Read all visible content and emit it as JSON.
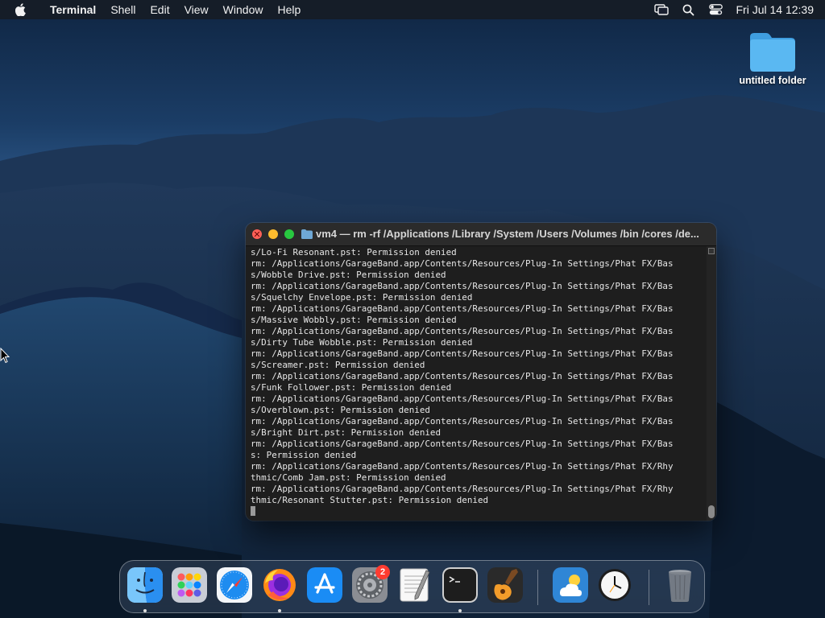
{
  "menubar": {
    "app_name": "Terminal",
    "menus": [
      "Shell",
      "Edit",
      "View",
      "Window",
      "Help"
    ],
    "clock": "Fri Jul 14  12:39"
  },
  "desktop": {
    "folder_label": "untitled folder"
  },
  "terminal": {
    "title": "vm4 — rm -rf /Applications /Library /System /Users /Volumes /bin /cores /de...",
    "lines": [
      "s/Lo-Fi Resonant.pst: Permission denied",
      "rm: /Applications/GarageBand.app/Contents/Resources/Plug-In Settings/Phat FX/Bas",
      "s/Wobble Drive.pst: Permission denied",
      "rm: /Applications/GarageBand.app/Contents/Resources/Plug-In Settings/Phat FX/Bas",
      "s/Squelchy Envelope.pst: Permission denied",
      "rm: /Applications/GarageBand.app/Contents/Resources/Plug-In Settings/Phat FX/Bas",
      "s/Massive Wobbly.pst: Permission denied",
      "rm: /Applications/GarageBand.app/Contents/Resources/Plug-In Settings/Phat FX/Bas",
      "s/Dirty Tube Wobble.pst: Permission denied",
      "rm: /Applications/GarageBand.app/Contents/Resources/Plug-In Settings/Phat FX/Bas",
      "s/Screamer.pst: Permission denied",
      "rm: /Applications/GarageBand.app/Contents/Resources/Plug-In Settings/Phat FX/Bas",
      "s/Funk Follower.pst: Permission denied",
      "rm: /Applications/GarageBand.app/Contents/Resources/Plug-In Settings/Phat FX/Bas",
      "s/Overblown.pst: Permission denied",
      "rm: /Applications/GarageBand.app/Contents/Resources/Plug-In Settings/Phat FX/Bas",
      "s/Bright Dirt.pst: Permission denied",
      "rm: /Applications/GarageBand.app/Contents/Resources/Plug-In Settings/Phat FX/Bas",
      "s: Permission denied",
      "rm: /Applications/GarageBand.app/Contents/Resources/Plug-In Settings/Phat FX/Rhy",
      "thmic/Comb Jam.pst: Permission denied",
      "rm: /Applications/GarageBand.app/Contents/Resources/Plug-In Settings/Phat FX/Rhy",
      "thmic/Resonant Stutter.pst: Permission denied"
    ]
  },
  "dock": {
    "items": [
      {
        "icon": "finder-icon",
        "running": true
      },
      {
        "icon": "launchpad-icon",
        "running": false
      },
      {
        "icon": "safari-icon",
        "running": false
      },
      {
        "icon": "firefox-icon",
        "running": true
      },
      {
        "icon": "app-store-icon",
        "running": false
      },
      {
        "icon": "system-settings-icon",
        "running": false
      },
      {
        "icon": "textedit-icon",
        "running": false
      },
      {
        "icon": "terminal-icon",
        "running": true
      },
      {
        "icon": "garageband-icon",
        "running": false
      },
      {
        "icon": "weather-icon",
        "running": false
      },
      {
        "icon": "clock-icon",
        "running": false
      },
      {
        "icon": "trash-icon",
        "running": false
      }
    ],
    "settings_badge": "2"
  },
  "colors": {
    "terminal_bg": "#1e1e1e",
    "terminal_text": "#e6e6e6",
    "badge": "#ff3b30",
    "folder": "#54b4f0"
  }
}
